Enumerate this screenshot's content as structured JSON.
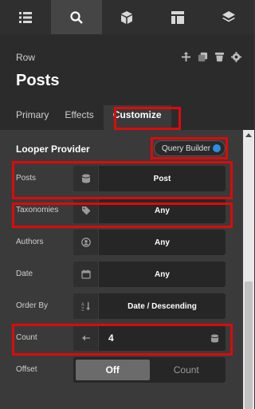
{
  "toolbar": {
    "icons": [
      "list-icon",
      "search-icon",
      "cube-icon",
      "layout-icon",
      "layers-icon"
    ],
    "active": "search-icon"
  },
  "header": {
    "breadcrumb": "Row",
    "title": "Posts",
    "actions": [
      "move-icon",
      "copy-icon",
      "delete-icon",
      "settings-icon"
    ]
  },
  "tabs": [
    {
      "label": "Primary"
    },
    {
      "label": "Effects"
    },
    {
      "label": "Customize",
      "active": true
    }
  ],
  "looper": {
    "title": "Looper Provider",
    "query_builder_label": "Query Builder",
    "query_builder_on": true
  },
  "fields": {
    "posts": {
      "label": "Posts",
      "value": "Post"
    },
    "taxonomies": {
      "label": "Taxonomies",
      "value": "Any"
    },
    "authors": {
      "label": "Authors",
      "value": "Any"
    },
    "date": {
      "label": "Date",
      "value": "Any"
    },
    "order_by": {
      "label": "Order By",
      "value": "Date / Descending"
    },
    "count": {
      "label": "Count",
      "value": "4"
    },
    "offset": {
      "label": "Offset",
      "options": [
        "Off",
        "Count"
      ],
      "selected": "Off"
    }
  },
  "colors": {
    "accent": "#2b8ee6",
    "highlight": "#dd0a0a"
  }
}
